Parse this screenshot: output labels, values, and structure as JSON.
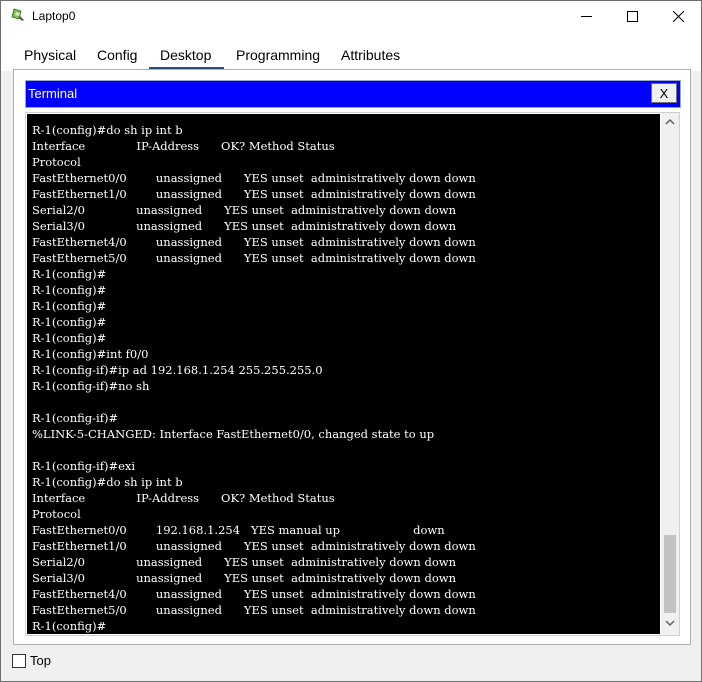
{
  "window": {
    "title": "Laptop0",
    "icon": "laptop-icon",
    "buttons": [
      "minimize-icon",
      "maximize-icon",
      "close-icon"
    ]
  },
  "tabs": [
    {
      "label": "Physical",
      "active": false
    },
    {
      "label": "Config",
      "active": false
    },
    {
      "label": "Desktop",
      "active": true
    },
    {
      "label": "Programming",
      "active": false
    },
    {
      "label": "Attributes",
      "active": false
    }
  ],
  "terminal": {
    "title": "Terminal",
    "close_label": "X",
    "lines": [
      "R-1(config)#do sh ip int b",
      "Interface              IP-Address      OK? Method Status",
      "Protocol",
      "FastEthernet0/0        unassigned      YES unset  administratively down down",
      "FastEthernet1/0        unassigned      YES unset  administratively down down",
      "Serial2/0              unassigned      YES unset  administratively down down",
      "Serial3/0              unassigned      YES unset  administratively down down",
      "FastEthernet4/0        unassigned      YES unset  administratively down down",
      "FastEthernet5/0        unassigned      YES unset  administratively down down",
      "R-1(config)#",
      "R-1(config)#",
      "R-1(config)#",
      "R-1(config)#",
      "R-1(config)#",
      "R-1(config)#int f0/0",
      "R-1(config-if)#ip ad 192.168.1.254 255.255.255.0",
      "R-1(config-if)#no sh",
      "",
      "R-1(config-if)#",
      "%LINK-5-CHANGED: Interface FastEthernet0/0, changed state to up",
      "",
      "R-1(config-if)#exi",
      "R-1(config)#do sh ip int b",
      "Interface              IP-Address      OK? Method Status",
      "Protocol",
      "FastEthernet0/0        192.168.1.254   YES manual up                    down",
      "FastEthernet1/0        unassigned      YES unset  administratively down down",
      "Serial2/0              unassigned      YES unset  administratively down down",
      "Serial3/0              unassigned      YES unset  administratively down down",
      "FastEthernet4/0        unassigned      YES unset  administratively down down",
      "FastEthernet5/0        unassigned      YES unset  administratively down down",
      "R-1(config)#"
    ]
  },
  "footer": {
    "top_label": "Top",
    "top_checked": false
  },
  "colors": {
    "terminal_titlebar": "#0000ff",
    "terminal_background": "#000000",
    "terminal_text": "#ffffff",
    "active_tab_underline": "#2b4f78"
  }
}
